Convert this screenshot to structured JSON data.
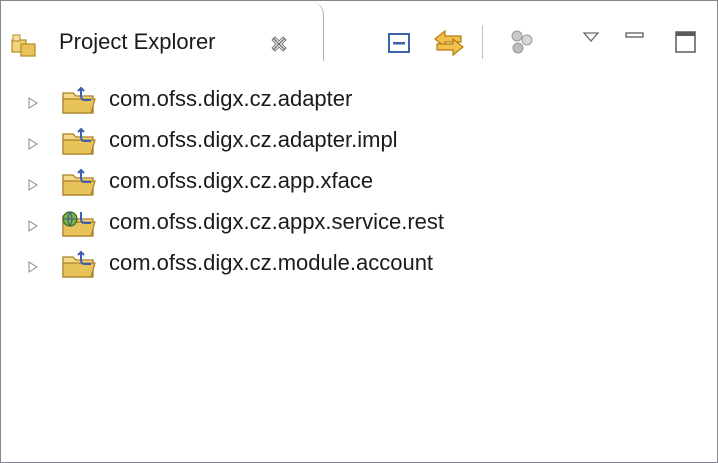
{
  "view": {
    "tab": {
      "title": "Project Explorer",
      "icon": "project-explorer-icon",
      "close_icon": "close-icon"
    },
    "toolbar": [
      {
        "name": "collapse-all-icon"
      },
      {
        "name": "link-with-editor-icon"
      },
      {
        "name": "filter-icon"
      },
      {
        "name": "view-menu-icon"
      },
      {
        "name": "minimize-icon"
      },
      {
        "name": "maximize-icon"
      }
    ]
  },
  "tree": {
    "items": [
      {
        "label": "com.ofss.digx.cz.adapter",
        "icon": "java-project-folder-icon",
        "expanded": false
      },
      {
        "label": "com.ofss.digx.cz.adapter.impl",
        "icon": "java-project-folder-icon",
        "expanded": false
      },
      {
        "label": "com.ofss.digx.cz.app.xface",
        "icon": "java-project-folder-icon",
        "expanded": false
      },
      {
        "label": "com.ofss.digx.cz.appx.service.rest",
        "icon": "web-service-project-icon",
        "expanded": false
      },
      {
        "label": "com.ofss.digx.cz.module.account",
        "icon": "java-project-folder-icon",
        "expanded": false
      }
    ]
  },
  "colors": {
    "border": "#828790",
    "tab_border": "#a9b4c2",
    "text": "#1b1b1b",
    "folder": "#e7c35a",
    "link_icon": "#e0a030"
  }
}
